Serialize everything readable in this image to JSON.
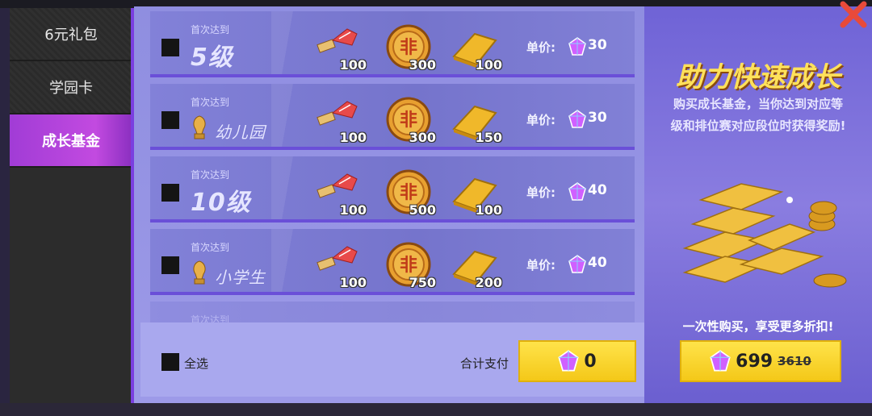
{
  "sidebar": {
    "items": [
      {
        "label": "6元礼包",
        "active": false
      },
      {
        "label": "学园卡",
        "active": false
      },
      {
        "label": "成长基金",
        "active": true
      }
    ]
  },
  "rows": [
    {
      "first_reach": "首次达到",
      "level": "5级",
      "rewards": [
        {
          "icon": "fan-ticket-icon",
          "count": "100"
        },
        {
          "icon": "coin-icon",
          "count": "300"
        },
        {
          "icon": "gold-bar-icon",
          "count": "100"
        }
      ],
      "price_label": "单价:",
      "price": "30"
    },
    {
      "first_reach": "首次达到",
      "level": "幼儿园",
      "rewards": [
        {
          "icon": "fan-ticket-icon",
          "count": "100"
        },
        {
          "icon": "coin-icon",
          "count": "300"
        },
        {
          "icon": "gold-bar-icon",
          "count": "150"
        }
      ],
      "price_label": "单价:",
      "price": "30"
    },
    {
      "first_reach": "首次达到",
      "level": "10级",
      "rewards": [
        {
          "icon": "fan-ticket-icon",
          "count": "100"
        },
        {
          "icon": "coin-icon",
          "count": "500"
        },
        {
          "icon": "gold-bar-icon",
          "count": "100"
        }
      ],
      "price_label": "单价:",
      "price": "40"
    },
    {
      "first_reach": "首次达到",
      "level": "小学生",
      "rewards": [
        {
          "icon": "fan-ticket-icon",
          "count": "100"
        },
        {
          "icon": "coin-icon",
          "count": "750"
        },
        {
          "icon": "gold-bar-icon",
          "count": "200"
        }
      ],
      "price_label": "单价:",
      "price": "40"
    },
    {
      "first_reach": "首次达到"
    }
  ],
  "bottom": {
    "select_all": "全选",
    "total_label": "合计支付",
    "total_value": "0"
  },
  "promo": {
    "title": "助力快速成长",
    "desc_line1": "购买成长基金，当你达到对应等",
    "desc_line2": "级和排位赛对应段位时获得奖励!",
    "sub": "一次性购买，享受更多折扣!",
    "price": "699",
    "original_price": "3610"
  },
  "colors": {
    "accent_purple": "#c24ae0",
    "button_yellow": "#f4c818",
    "promo_title": "#ffe15a"
  }
}
